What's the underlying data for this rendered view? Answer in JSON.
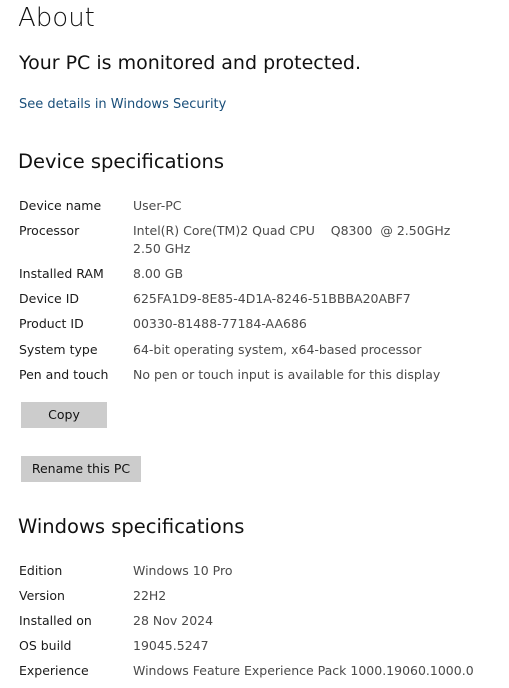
{
  "page": {
    "title": "About",
    "protection_message": "Your PC is monitored and protected.",
    "security_link": "See details in Windows Security"
  },
  "device_specs": {
    "heading": "Device specifications",
    "rows": [
      {
        "label": "Device name",
        "value": "User-PC"
      },
      {
        "label": "Processor",
        "value": "Intel(R) Core(TM)2 Quad CPU    Q8300  @ 2.50GHz\n2.50 GHz"
      },
      {
        "label": "Installed RAM",
        "value": "8.00 GB"
      },
      {
        "label": "Device ID",
        "value": "625FA1D9-8E85-4D1A-8246-51BBBA20ABF7"
      },
      {
        "label": "Product ID",
        "value": "00330-81488-77184-AA686"
      },
      {
        "label": "System type",
        "value": "64-bit operating system, x64-based processor"
      },
      {
        "label": "Pen and touch",
        "value": "No pen or touch input is available for this display"
      }
    ],
    "copy_button": "Copy",
    "rename_button": "Rename this PC"
  },
  "windows_specs": {
    "heading": "Windows specifications",
    "rows": [
      {
        "label": "Edition",
        "value": "Windows 10 Pro"
      },
      {
        "label": "Version",
        "value": "22H2"
      },
      {
        "label": "Installed on",
        "value": "28 Nov 2024"
      },
      {
        "label": "OS build",
        "value": "19045.5247"
      },
      {
        "label": "Experience",
        "value": "Windows Feature Experience Pack 1000.19060.1000.0"
      }
    ]
  }
}
